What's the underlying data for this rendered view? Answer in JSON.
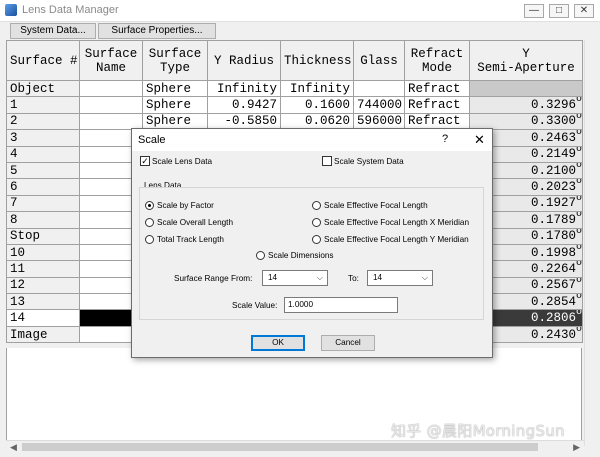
{
  "window": {
    "title": "Lens Data Manager"
  },
  "toolbar": {
    "system_data": "System Data...",
    "surface_properties": "Surface Properties..."
  },
  "columns": [
    "Surface #",
    "Surface\nName",
    "Surface\nType",
    "Y Radius",
    "Thickness",
    "Glass",
    "Refract\nMode",
    "Y\nSemi-Aperture"
  ],
  "rows": [
    {
      "surface": "Object",
      "name": "",
      "type": "Sphere",
      "radius": "Infinity",
      "thickness": "Infinity",
      "glass": "",
      "mode": "Refract",
      "semi": ""
    },
    {
      "surface": "1",
      "name": "",
      "type": "Sphere",
      "radius": "0.9427",
      "thickness": "0.1600",
      "glass": "744000",
      "mode": "Refract",
      "semi": "0.3296"
    },
    {
      "surface": "2",
      "name": "",
      "type": "Sphere",
      "radius": "-0.5850",
      "thickness": "0.0620",
      "glass": "596000",
      "mode": "Refract",
      "semi": "0.3300"
    },
    {
      "surface": "3",
      "semi": "0.2463"
    },
    {
      "surface": "4",
      "semi": "0.2149"
    },
    {
      "surface": "5",
      "semi": "0.2100"
    },
    {
      "surface": "6",
      "semi": "0.2023"
    },
    {
      "surface": "7",
      "semi": "0.1927"
    },
    {
      "surface": "8",
      "semi": "0.1789"
    },
    {
      "surface": "Stop",
      "semi": "0.1780"
    },
    {
      "surface": "10",
      "semi": "0.1998"
    },
    {
      "surface": "11",
      "semi": "0.2264"
    },
    {
      "surface": "12",
      "semi": "0.2567"
    },
    {
      "surface": "13",
      "semi": "0.2854"
    },
    {
      "surface": "14",
      "semi": "0.2806"
    },
    {
      "surface": "Image",
      "semi": "0.2430"
    }
  ],
  "marker": "o",
  "dialog": {
    "title": "Scale",
    "help": "?",
    "close": "✕",
    "scale_lens_data": "Scale Lens Data",
    "scale_system_data": "Scale System Data",
    "group_label": "Lens Data",
    "opt_by_factor": "Scale by Factor",
    "opt_overall_length": "Scale Overall Length",
    "opt_total_track": "Total Track Length",
    "opt_dimensions": "Scale Dimensions",
    "opt_efl": "Scale Effective Focal Length",
    "opt_efl_x": "Scale Effective Focal Length X Meridian",
    "opt_efl_y": "Scale Effective Focal Length Y Meridian",
    "surface_range": "Surface Range",
    "from": "From:",
    "from_value": "14",
    "to": "To:",
    "to_value": "14",
    "scale_value_label": "Scale Value:",
    "scale_value": "1.0000",
    "ok": "OK",
    "cancel": "Cancel"
  },
  "watermark": "知乎 @晨阳MorningSun"
}
